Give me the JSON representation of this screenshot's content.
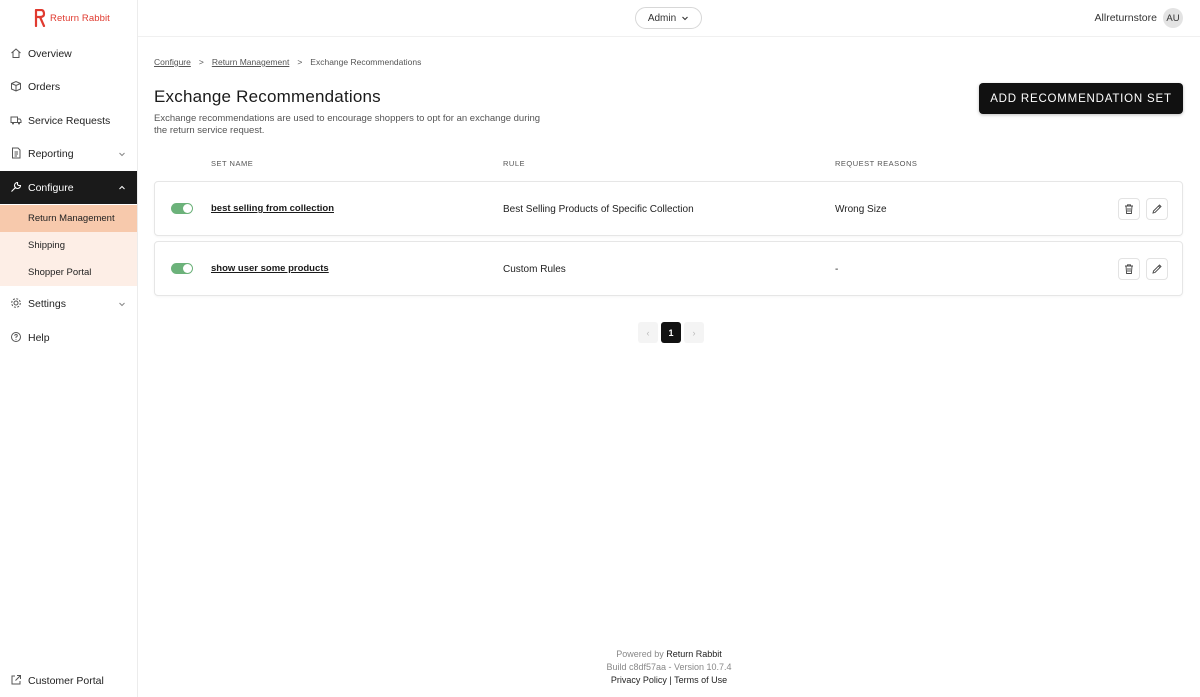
{
  "brand": {
    "name": "Return Rabbit",
    "color": "#e03a2f"
  },
  "sidebar": {
    "items": [
      {
        "label": "Overview",
        "icon": "home-icon"
      },
      {
        "label": "Orders",
        "icon": "box-icon"
      },
      {
        "label": "Service Requests",
        "icon": "truck-icon"
      },
      {
        "label": "Reporting",
        "icon": "report-icon"
      },
      {
        "label": "Configure",
        "icon": "wrench-icon"
      },
      {
        "label": "Settings",
        "icon": "gear-icon"
      },
      {
        "label": "Help",
        "icon": "help-icon"
      }
    ],
    "configure_sub": [
      {
        "label": "Return Management"
      },
      {
        "label": "Shipping"
      },
      {
        "label": "Shopper Portal"
      }
    ],
    "bottom": {
      "label": "Customer Portal",
      "icon": "external-link-icon"
    }
  },
  "topbar": {
    "role_label": "Admin",
    "store_name": "Allreturnstore",
    "avatar_initials": "AU"
  },
  "breadcrumb": {
    "items": [
      "Configure",
      "Return Management",
      "Exchange Recommendations"
    ],
    "separator": ">"
  },
  "page": {
    "title": "Exchange Recommendations",
    "description": "Exchange recommendations are used to encourage shoppers to opt for an exchange during the return service request.",
    "add_button": "ADD RECOMMENDATION SET"
  },
  "table": {
    "headers": {
      "set_name": "SET NAME",
      "rule": "RULE",
      "request_reasons": "REQUEST REASONS"
    },
    "rows": [
      {
        "enabled": true,
        "set_name": "best selling from collection",
        "rule": "Best Selling Products of Specific Collection",
        "request_reasons": "Wrong Size"
      },
      {
        "enabled": true,
        "set_name": "show user some products",
        "rule": "Custom Rules",
        "request_reasons": "-"
      }
    ]
  },
  "pagination": {
    "current": "1",
    "prev": "‹",
    "next": "›"
  },
  "footer": {
    "powered_prefix": "Powered by",
    "powered_name": "Return Rabbit",
    "build": "Build c8df57aa - Version 10.7.4",
    "privacy": "Privacy Policy",
    "divider": "|",
    "terms": "Terms of Use"
  },
  "colors": {
    "toggle_on": "#6cb27a",
    "active_nav": "#1a1a1a",
    "sub_bg": "#fdeee6",
    "sub_selected": "#f7c9ac"
  }
}
